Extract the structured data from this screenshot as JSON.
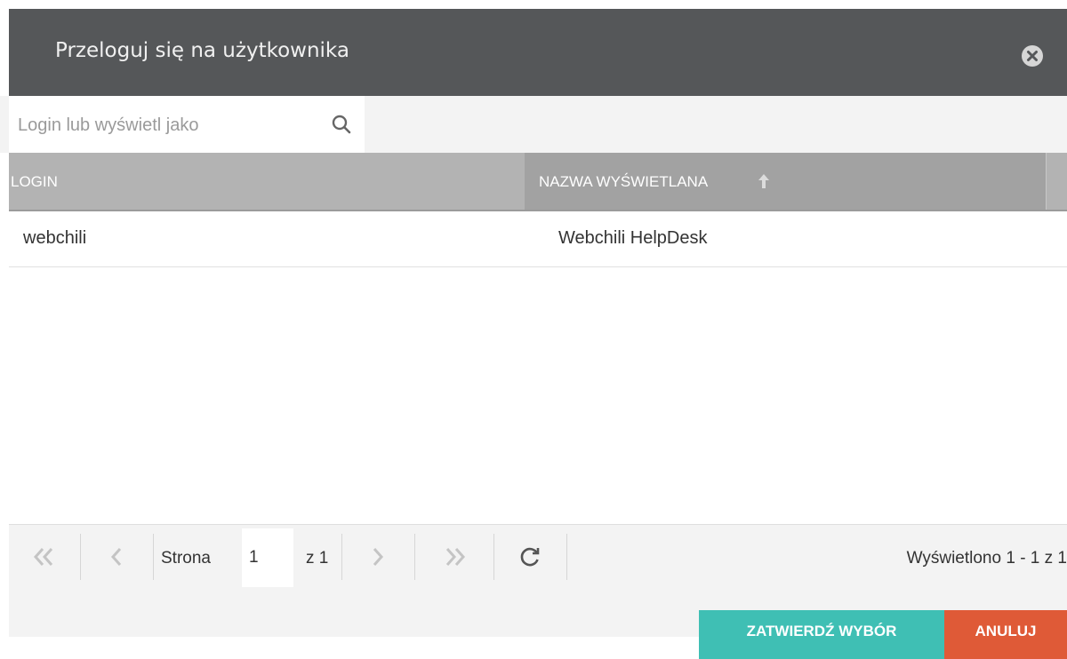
{
  "dialog": {
    "title": "Przeloguj się na użytkownika",
    "close_icon": "close-circle-icon"
  },
  "search": {
    "placeholder": "Login lub wyświetl jako",
    "value": "",
    "icon": "search-icon"
  },
  "grid": {
    "columns": [
      {
        "label": "LOGIN"
      },
      {
        "label": "NAZWA WYŚWIETLANA",
        "sort": "ascending"
      }
    ],
    "rows": [
      {
        "login": "webchili",
        "display_name": "Webchili HelpDesk"
      }
    ]
  },
  "pager": {
    "page_label": "Strona",
    "page_value": "1",
    "of_label": "z 1",
    "info": "Wyświetlono 1 - 1 z 1",
    "icons": [
      "first-page-icon",
      "prev-page-icon",
      "next-page-icon",
      "last-page-icon",
      "refresh-icon"
    ]
  },
  "footer": {
    "confirm_label": "ZATWIERDŹ WYBÓR",
    "cancel_label": "ANULUJ"
  },
  "colors": {
    "title_bar": "#555759",
    "header": "#b3b3b3",
    "header_sorted": "#a2a2a2",
    "confirm": "#3fbfb4",
    "cancel": "#df5a37"
  }
}
